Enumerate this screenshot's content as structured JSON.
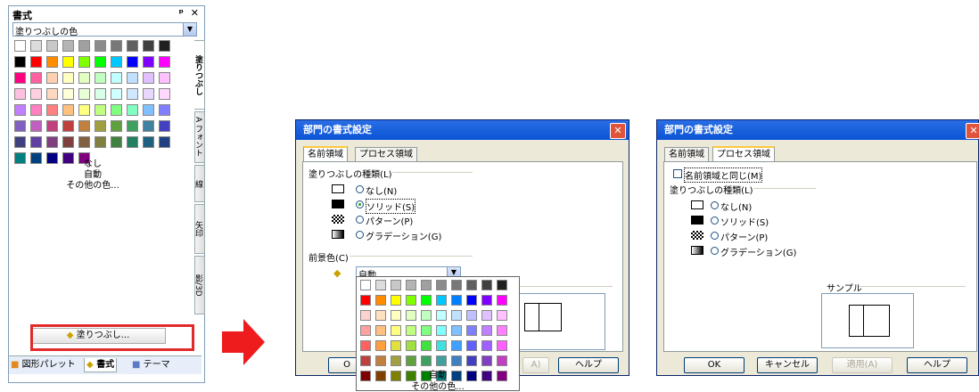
{
  "pane": {
    "title": "書式",
    "controls": "ᵖ ✕",
    "dropdown_value": "塗りつぶしの色",
    "palette": [
      [
        "#ffffff",
        "#dcdcdc",
        "#c8c8c8",
        "#b4b4b4",
        "#a0a0a0",
        "#8c8c8c",
        "#787878",
        "#606060",
        "#404040",
        "#202020"
      ],
      [
        "#000000",
        "#ff0000",
        "#ff8c00",
        "#ffff00",
        "#80ff00",
        "#00ff00",
        "#00c8ff",
        "#0000ff",
        "#8000ff",
        "#ff00ff"
      ],
      [
        "#ff0080",
        "#ff60a0",
        "#ffd0b0",
        "#ffffc0",
        "#e0ffc0",
        "#c0ffc0",
        "#c0ffff",
        "#c0e0ff",
        "#e0c0ff",
        "#ffc0ff"
      ],
      [
        "#ffc0e0",
        "#ffd0e0",
        "#ffd8c0",
        "#ffffd8",
        "#e8ffd8",
        "#d8ffe8",
        "#d0ffff",
        "#d0e8ff",
        "#e8d8ff",
        "#ffd8ff"
      ],
      [
        "#c080ff",
        "#ff80c0",
        "#ff8080",
        "#ffc080",
        "#ffff80",
        "#c0ff80",
        "#80ff80",
        "#80ffc0",
        "#80c0ff",
        "#8080ff"
      ],
      [
        "#8060c0",
        "#c060c0",
        "#c04080",
        "#c04040",
        "#c08040",
        "#a0a040",
        "#60a040",
        "#40a060",
        "#4080a0",
        "#4040c0"
      ],
      [
        "#404080",
        "#6040a0",
        "#804080",
        "#804040",
        "#806040",
        "#808040",
        "#408040",
        "#208060",
        "#206080",
        "#204080"
      ],
      [
        "#008080",
        "#004080",
        "#000080",
        "#400080",
        "#800080"
      ]
    ],
    "none_label": "なし",
    "auto_label": "自動",
    "more_colors_label": "その他の色...",
    "vtabs": [
      "塗りつぶし",
      "A フォント",
      "線",
      "矢印",
      "影/3D"
    ],
    "fill_button_label": "塗りつぶし...",
    "bottom_tabs": [
      "図形パレット",
      "書式",
      "テーマ"
    ]
  },
  "dialog1": {
    "title": "部門の書式設定",
    "tabs": [
      "名前領域",
      "プロセス領域"
    ],
    "group_fill_type": "塗りつぶしの種類(L)",
    "options": [
      "なし(N)",
      "ソリッド(S)",
      "パターン(P)",
      "グラデーション(G)"
    ],
    "selected_option": 1,
    "group_fg_color": "前景色(C)",
    "fg_value": "自動",
    "popup_palette": [
      [
        "#ffffff",
        "#dcdcdc",
        "#c8c8c8",
        "#b4b4b4",
        "#a0a0a0",
        "#8c8c8c",
        "#787878",
        "#606060",
        "#404040",
        "#202020"
      ],
      [
        "#ff0000",
        "#ff8c00",
        "#ffff00",
        "#80ff00",
        "#00ff00",
        "#00c8ff",
        "#0080ff",
        "#0000ff",
        "#8000ff",
        "#ff00ff"
      ],
      [
        "#ffd0d0",
        "#ffe0c0",
        "#ffffc0",
        "#e0ffc0",
        "#c0ffc0",
        "#c0ffff",
        "#c0e0ff",
        "#c0c0ff",
        "#e0c0ff",
        "#ffc0ff"
      ],
      [
        "#ffa0a0",
        "#ffc080",
        "#ffff80",
        "#c0ff80",
        "#80ff80",
        "#80ffff",
        "#80c0ff",
        "#8080ff",
        "#c080ff",
        "#ff80ff"
      ],
      [
        "#ff6060",
        "#ffa040",
        "#e0e040",
        "#a0e040",
        "#40e040",
        "#40e0e0",
        "#40a0ff",
        "#6060ff",
        "#a060ff",
        "#ff60ff"
      ],
      [
        "#c04040",
        "#c08040",
        "#a0a040",
        "#60a040",
        "#40a060",
        "#40a0a0",
        "#4080c0",
        "#4040c0",
        "#8040c0",
        "#c040c0"
      ],
      [
        "#800000",
        "#804000",
        "#808000",
        "#408000",
        "#008000",
        "#008080",
        "#004080",
        "#000080",
        "#400080",
        "#800080"
      ]
    ],
    "popup_auto": "自動",
    "popup_more": "その他の色...",
    "buttons": [
      "O",
      "A)",
      "ヘルプ"
    ]
  },
  "dialog2": {
    "title": "部門の書式設定",
    "tabs": [
      "名前領域",
      "プロセス領域"
    ],
    "checkbox_label": "名前領域と同じ(M)",
    "group_fill_type": "塗りつぶしの種類(L)",
    "options": [
      "なし(N)",
      "ソリッド(S)",
      "パターン(P)",
      "グラデーション(G)"
    ],
    "sample_label": "サンプル",
    "buttons": [
      "OK",
      "キャンセル",
      "適用(A)",
      "ヘルプ"
    ]
  },
  "colors": {
    "accent_red": "#e32a2a",
    "title_blue": "#0a54d4"
  }
}
